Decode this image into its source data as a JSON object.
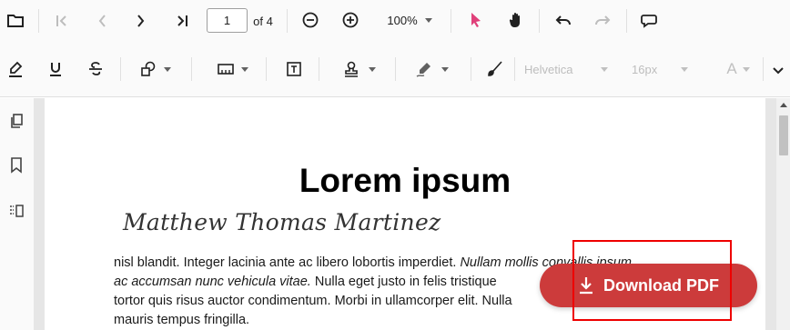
{
  "toolbar": {
    "page_number": "1",
    "page_of": "of 4",
    "zoom": "100%",
    "font_family": "Helvetica",
    "font_size": "16px",
    "font_color_label": "A"
  },
  "document": {
    "title": "Lorem ipsum",
    "signature": "Matthew Thomas Martinez",
    "paragraph": [
      {
        "normal": "nisl blandit. Integer lacinia ante ac libero lobortis imperdiet. ",
        "italic": "Nullam mollis convallis ipsum,"
      },
      {
        "italic": "ac accumsan nunc vehicula vitae.",
        "normal": " Nulla eget justo in felis tristique"
      },
      {
        "normal": "tortor quis risus auctor condimentum. Morbi in ullamcorper elit. Nulla"
      },
      {
        "normal": "mauris tempus fringilla."
      }
    ]
  },
  "download_button": {
    "label": "Download PDF"
  },
  "colors": {
    "accent_pink": "#e0407a",
    "download_red": "#cc3b3b",
    "highlight_border": "#ee0000"
  }
}
